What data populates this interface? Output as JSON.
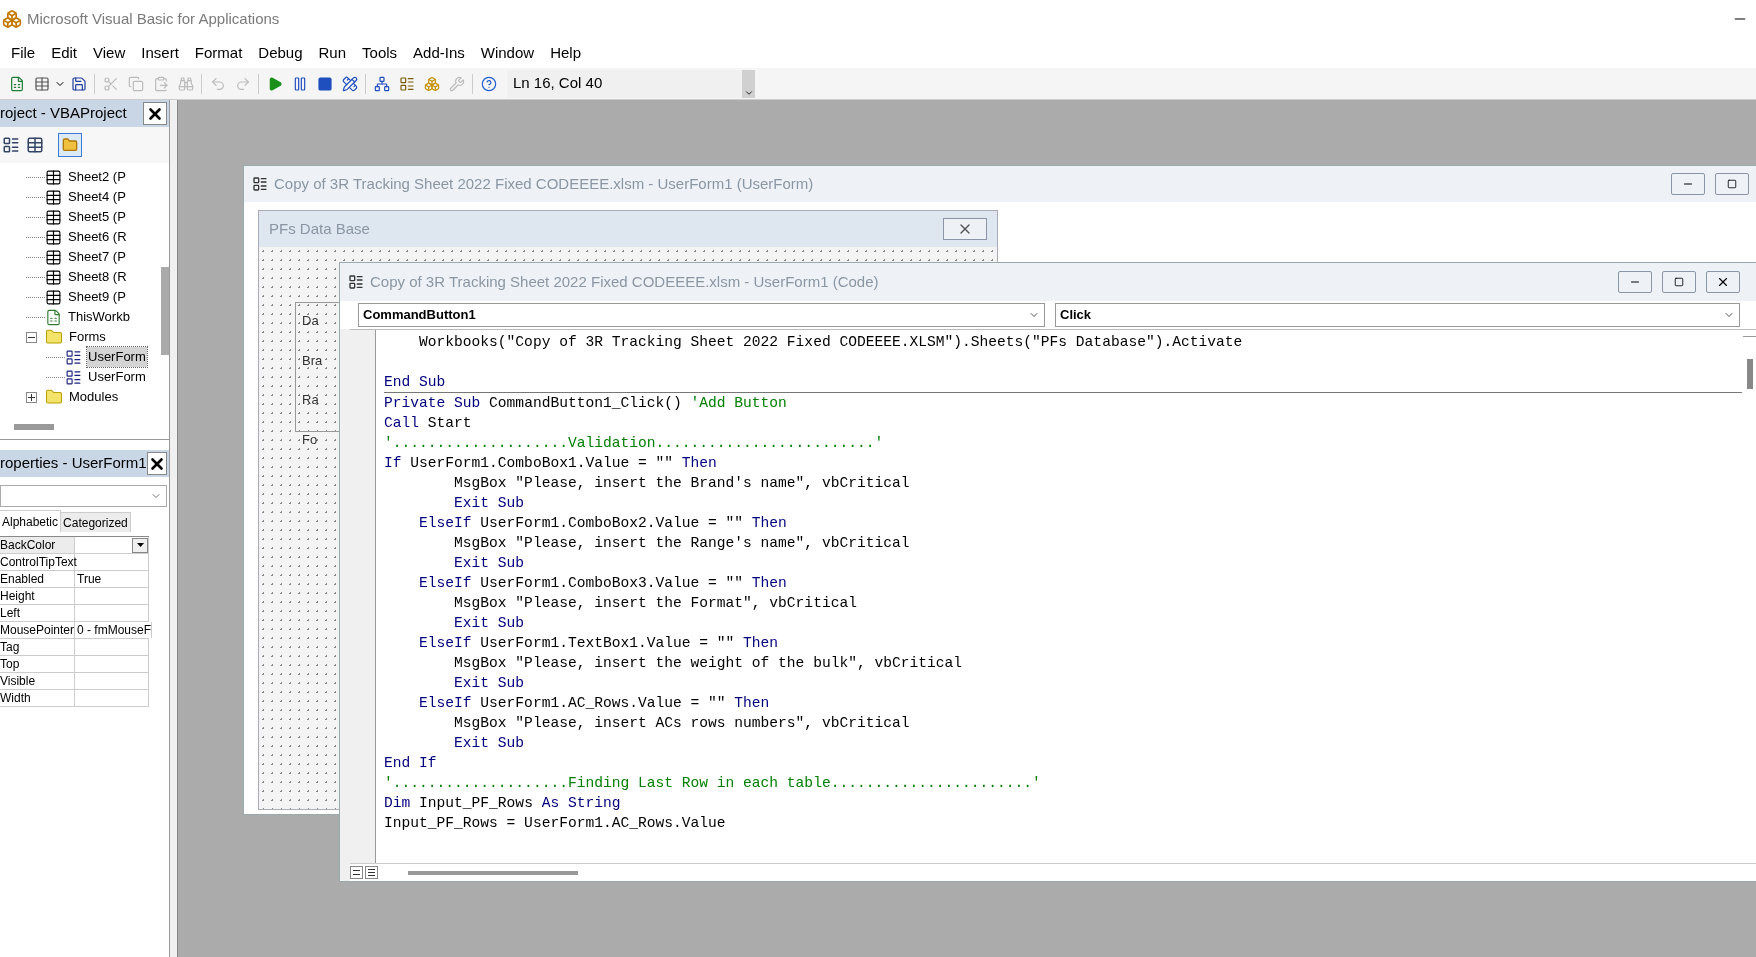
{
  "window": {
    "title": "Microsoft Visual Basic for Applications"
  },
  "menu": [
    "File",
    "Edit",
    "View",
    "Insert",
    "Format",
    "Debug",
    "Run",
    "Tools",
    "Add-Ins",
    "Window",
    "Help"
  ],
  "toolbar": {
    "position": "Ln 16, Col 40"
  },
  "project_panel": {
    "title": "roject - VBAProject",
    "tree": [
      {
        "label": "Sheet2 (P",
        "kind": "sheet",
        "selected": false
      },
      {
        "label": "Sheet4 (P",
        "kind": "sheet",
        "selected": false
      },
      {
        "label": "Sheet5 (P",
        "kind": "sheet",
        "selected": false
      },
      {
        "label": "Sheet6 (R",
        "kind": "sheet",
        "selected": false
      },
      {
        "label": "Sheet7 (P",
        "kind": "sheet",
        "selected": false
      },
      {
        "label": "Sheet8 (R",
        "kind": "sheet",
        "selected": false
      },
      {
        "label": "Sheet9 (P",
        "kind": "sheet",
        "selected": false
      },
      {
        "label": "ThisWorkb",
        "kind": "workbook",
        "selected": false
      },
      {
        "label": "Forms",
        "kind": "folder",
        "expanded": true,
        "selected": false,
        "children": [
          {
            "label": "UserForm",
            "kind": "form",
            "selected": true
          },
          {
            "label": "UserForm",
            "kind": "form",
            "selected": false
          }
        ]
      },
      {
        "label": "Modules",
        "kind": "folder",
        "expanded": false,
        "selected": false
      }
    ]
  },
  "properties_panel": {
    "title": "roperties - UserForm1",
    "tabs": [
      {
        "label": "Alphabetic",
        "selected": true
      },
      {
        "label": "Categorized",
        "selected": false
      }
    ],
    "rows": [
      {
        "name": "BackColor",
        "value": "",
        "selected": true
      },
      {
        "name": "ControlTipText",
        "value": "",
        "selected": false
      },
      {
        "name": "Enabled",
        "value": "True",
        "selected": false
      },
      {
        "name": "Height",
        "value": "",
        "selected": false
      },
      {
        "name": "Left",
        "value": "",
        "selected": false
      },
      {
        "name": "MousePointer",
        "value": "0 - fmMouseF",
        "selected": false
      },
      {
        "name": "Tag",
        "value": "",
        "selected": false
      },
      {
        "name": "Top",
        "value": "",
        "selected": false
      },
      {
        "name": "Visible",
        "value": "",
        "selected": false
      },
      {
        "name": "Width",
        "value": "",
        "selected": false
      }
    ]
  },
  "designer_window": {
    "title": "Copy of 3R Tracking Sheet 2022 Fixed CODEEEE.xlsm - UserForm1 (UserForm)",
    "form_title": "PFs Data Base",
    "form_labels": [
      "Da",
      "Bra",
      "Ra",
      "Fo"
    ]
  },
  "code_window": {
    "title": "Copy of 3R Tracking Sheet 2022 Fixed CODEEEE.xlsm - UserForm1 (Code)",
    "object": "CommandButton1",
    "procedure": "Click",
    "procedures": [
      {
        "lines": [
          {
            "kind": "code",
            "segments": [
              {
                "kind": "text",
                "text": "    Workbooks(\"Copy of 3R Tracking Sheet 2022 Fixed CODEEEE.XLSM\").Sheets(\"PFs Database\").Activate"
              }
            ]
          },
          {
            "kind": "blank"
          },
          {
            "kind": "code",
            "segments": [
              {
                "kind": "keyword",
                "text": "End Sub"
              }
            ]
          }
        ]
      },
      {
        "lines": [
          {
            "kind": "code",
            "segments": [
              {
                "kind": "keyword",
                "text": "Private Sub"
              },
              {
                "kind": "text",
                "text": " CommandButton1_Click() "
              },
              {
                "kind": "comment",
                "text": "'Add Button"
              }
            ]
          },
          {
            "kind": "code",
            "segments": [
              {
                "kind": "keyword",
                "text": "Call"
              },
              {
                "kind": "text",
                "text": " Start"
              }
            ]
          },
          {
            "kind": "code",
            "segments": [
              {
                "kind": "comment",
                "text": "'....................Validation.........................'"
              }
            ]
          },
          {
            "kind": "code",
            "segments": [
              {
                "kind": "keyword",
                "text": "If"
              },
              {
                "kind": "text",
                "text": " UserForm1.ComboBox1.Value = \"\" "
              },
              {
                "kind": "keyword",
                "text": "Then"
              }
            ]
          },
          {
            "kind": "code",
            "segments": [
              {
                "kind": "text",
                "text": "        MsgBox \"Please, insert the Brand's name\", vbCritical"
              }
            ]
          },
          {
            "kind": "code",
            "segments": [
              {
                "kind": "keyword",
                "text": "        Exit Sub"
              }
            ]
          },
          {
            "kind": "code",
            "segments": [
              {
                "kind": "keyword",
                "text": "    ElseIf"
              },
              {
                "kind": "text",
                "text": " UserForm1.ComboBox2.Value = \"\" "
              },
              {
                "kind": "keyword",
                "text": "Then"
              }
            ]
          },
          {
            "kind": "code",
            "segments": [
              {
                "kind": "text",
                "text": "        MsgBox \"Please, insert the Range's name\", vbCritical"
              }
            ]
          },
          {
            "kind": "code",
            "segments": [
              {
                "kind": "keyword",
                "text": "        Exit Sub"
              }
            ]
          },
          {
            "kind": "code",
            "segments": [
              {
                "kind": "keyword",
                "text": "    ElseIf"
              },
              {
                "kind": "text",
                "text": " UserForm1.ComboBox3.Value = \"\" "
              },
              {
                "kind": "keyword",
                "text": "Then"
              }
            ]
          },
          {
            "kind": "code",
            "segments": [
              {
                "kind": "text",
                "text": "        MsgBox \"Please, insert the Format\", vbCritical"
              }
            ]
          },
          {
            "kind": "code",
            "segments": [
              {
                "kind": "keyword",
                "text": "        Exit Sub"
              }
            ]
          },
          {
            "kind": "code",
            "segments": [
              {
                "kind": "keyword",
                "text": "    ElseIf"
              },
              {
                "kind": "text",
                "text": " UserForm1.TextBox1.Value = \"\" "
              },
              {
                "kind": "keyword",
                "text": "Then"
              }
            ]
          },
          {
            "kind": "code",
            "segments": [
              {
                "kind": "text",
                "text": "        MsgBox \"Please, insert the weight of the bulk\", vbCritical"
              }
            ]
          },
          {
            "kind": "code",
            "segments": [
              {
                "kind": "keyword",
                "text": "        Exit Sub"
              }
            ]
          },
          {
            "kind": "code",
            "segments": [
              {
                "kind": "keyword",
                "text": "    ElseIf"
              },
              {
                "kind": "text",
                "text": " UserForm1.AC_Rows.Value = \"\" "
              },
              {
                "kind": "keyword",
                "text": "Then"
              }
            ]
          },
          {
            "kind": "code",
            "segments": [
              {
                "kind": "text",
                "text": "        MsgBox \"Please, insert ACs rows numbers\", vbCritical"
              }
            ]
          },
          {
            "kind": "code",
            "segments": [
              {
                "kind": "keyword",
                "text": "        Exit Sub"
              }
            ]
          },
          {
            "kind": "code",
            "segments": [
              {
                "kind": "keyword",
                "text": "End If"
              }
            ]
          },
          {
            "kind": "code",
            "segments": [
              {
                "kind": "comment",
                "text": "'....................Finding Last Row in each table.......................'"
              }
            ]
          },
          {
            "kind": "code",
            "segments": [
              {
                "kind": "keyword",
                "text": "Dim"
              },
              {
                "kind": "text",
                "text": " Input_PF_Rows "
              },
              {
                "kind": "keyword",
                "text": "As String"
              }
            ]
          },
          {
            "kind": "code",
            "segments": [
              {
                "kind": "text",
                "text": "Input_PF_Rows = UserForm1.AC_Rows.Value"
              }
            ]
          }
        ]
      }
    ]
  }
}
